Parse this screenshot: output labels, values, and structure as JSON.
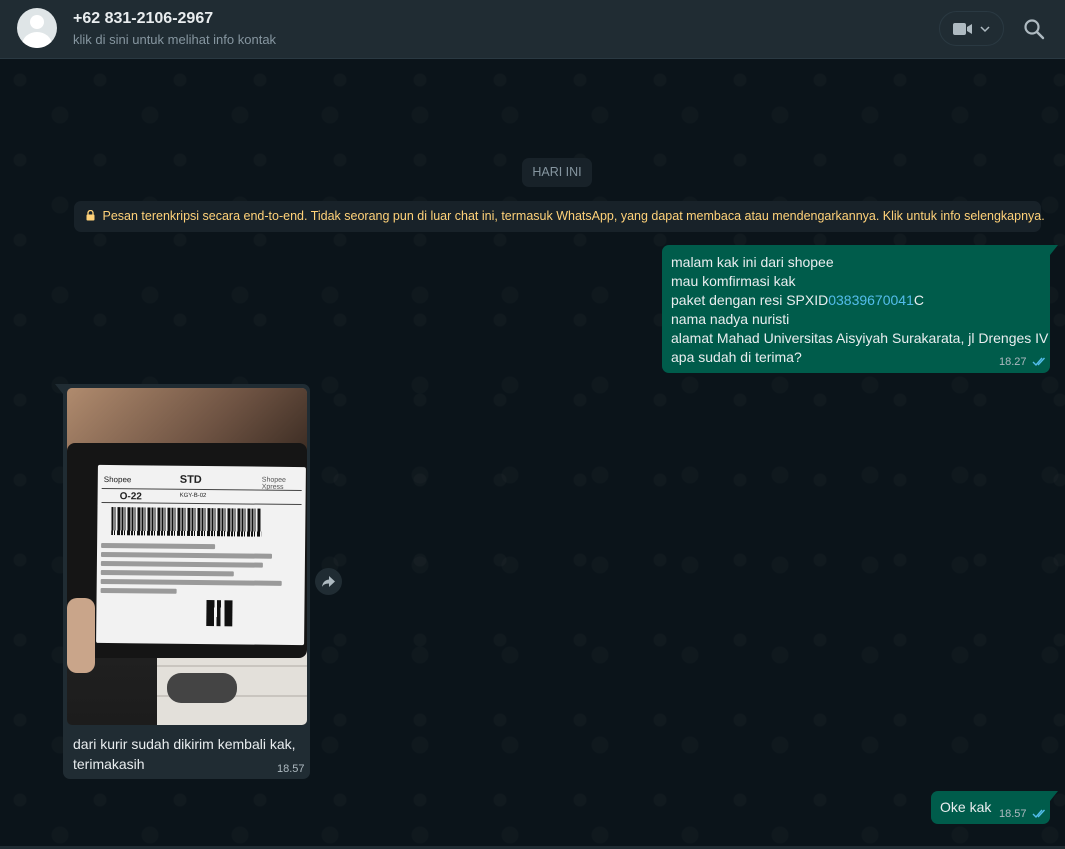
{
  "header": {
    "contact_name": "+62 831-2106-2967",
    "contact_subtitle": "klik di sini untuk melihat info kontak",
    "icons": [
      "avatar",
      "video-call-icon",
      "chevron-down-icon",
      "search-icon"
    ]
  },
  "chat": {
    "date_chip": "HARI INI",
    "encryption_notice": "Pesan terenkripsi secara end-to-end. Tidak seorang pun di luar chat ini, termasuk WhatsApp, yang dapat membaca atau mendengarkannya. Klik untuk info selengkapnya.",
    "messages": [
      {
        "direction": "outgoing",
        "lines": {
          "l1": "malam kak ini dari shopee",
          "l2": "mau komfirmasi kak",
          "l3_prefix": "paket dengan resi SPXID",
          "l3_link": "03839670041",
          "l3_suffix": "C",
          "l4": "nama nadya nuristi",
          "l5": "alamat Mahad Universitas Aisyiyah Surakarata, jl Drenges IV",
          "l6": "apa sudah di terima?"
        },
        "time": "18.27",
        "status": "read"
      },
      {
        "direction": "incoming",
        "image_label": {
          "brand": "Shopee",
          "service": "STD",
          "express": "Shopee Xpress",
          "sort_code": "O-22",
          "route": "KGY-B-02"
        },
        "caption_l1": "dari kurir sudah dikirim kembali kak,",
        "caption_l2": "terimakasih",
        "time": "18.57"
      },
      {
        "direction": "outgoing",
        "text": "Oke kak",
        "time": "18.57",
        "status": "read"
      }
    ]
  },
  "colors": {
    "background": "#0b141a",
    "header": "#202c33",
    "outgoing_bubble": "#005c4b",
    "incoming_bubble": "#202c33",
    "link": "#53bdeb",
    "read_ticks": "#53bdeb",
    "notice_text": "#ffd279"
  }
}
